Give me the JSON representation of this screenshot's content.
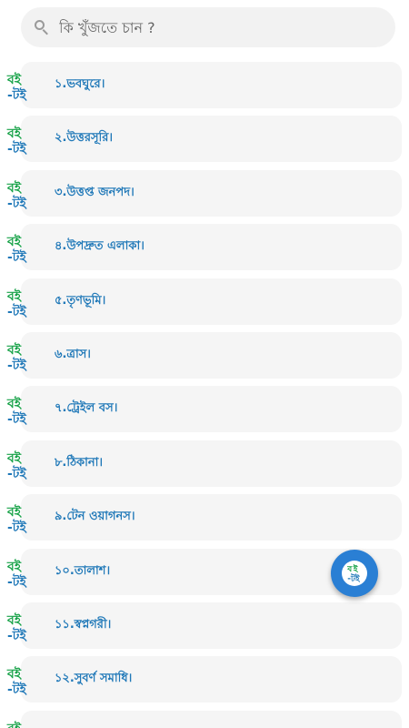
{
  "search": {
    "placeholder": "কি খুঁজতে চান ?"
  },
  "items": [
    {
      "label": "১.ভবঘুরে।"
    },
    {
      "label": "২.উত্তরসূরি।"
    },
    {
      "label": "৩.উত্তপ্ত জনপদ।"
    },
    {
      "label": "৪.উপদ্রুত এলাকা।"
    },
    {
      "label": "৫.তৃণভূমি।"
    },
    {
      "label": "৬.ত্রাস।"
    },
    {
      "label": "৭.ট্রেইল বস।"
    },
    {
      "label": "৮.ঠিকানা।"
    },
    {
      "label": "৯.টেন ওয়াগনস।"
    },
    {
      "label": "১০.তালাশ।"
    },
    {
      "label": "১১.স্বপ্নগরী।"
    },
    {
      "label": "১২.সুবর্ণ সমাধি।"
    },
    {
      "label": ""
    }
  ],
  "logo": {
    "alt": "বই-টই"
  },
  "colors": {
    "accent": "#2a7fd4",
    "label": "#1f78b8",
    "logo_green": "#1aa34a",
    "logo_blue": "#1f78b8"
  }
}
